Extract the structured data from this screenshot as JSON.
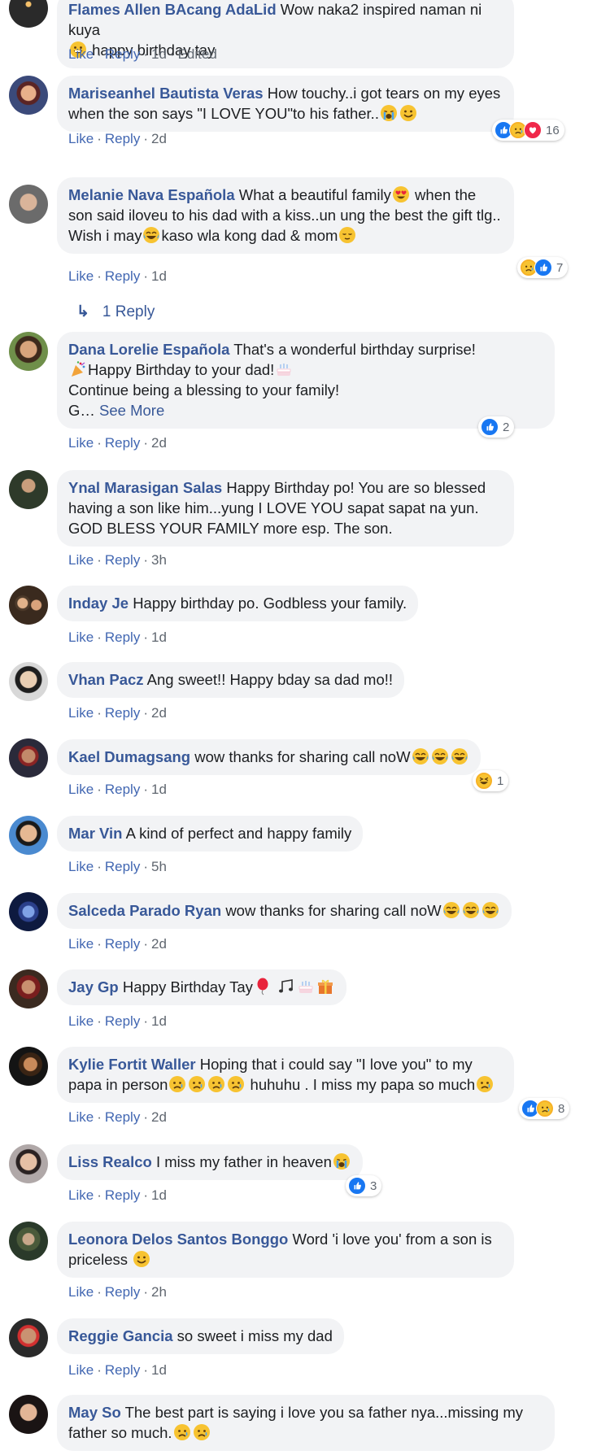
{
  "actions": {
    "like": "Like",
    "reply": "Reply",
    "sep": "·",
    "edited": "Edited"
  },
  "comments": [
    {
      "author": "Flames Allen BAcang AdaLid",
      "parts": [
        "Wow naka2 inspired naman ni kuya",
        "happy birthday tay"
      ],
      "time": "1d",
      "edited": true
    },
    {
      "author": "Mariseanhel Bautista Veras",
      "parts": [
        "How touchy..i got tears on my eyes when the son says \"I LOVE YOU\"to his father.."
      ],
      "time": "2d",
      "reaction_count": "16"
    },
    {
      "author": "Melanie Nava Española",
      "parts": [
        "What a beautiful family",
        " when the son said iloveu to his dad with a kiss..un ung the best the gift tlg.. Wish i may",
        "kaso wla kong dad & mom"
      ],
      "time": "1d",
      "reaction_count": "7",
      "replies_label": "1 Reply"
    },
    {
      "author": "Dana Lorelie Española",
      "parts": [
        "That's a wonderful birthday surprise!",
        "Happy Birthday to your dad!",
        "Continue being a blessing to your family!",
        "G…"
      ],
      "see_more": "See More",
      "time": "2d",
      "reaction_count": "2"
    },
    {
      "author": "Ynal Marasigan Salas",
      "parts": [
        "Happy Birthday po! You are so blessed having a son like him...yung I LOVE YOU sapat sapat na yun. GOD BLESS YOUR FAMILY more esp. The son."
      ],
      "time": "3h"
    },
    {
      "author": "Inday Je",
      "parts": [
        "Happy birthday po. Godbless your family."
      ],
      "time": "1d"
    },
    {
      "author": "Vhan Pacz",
      "parts": [
        "Ang sweet!! Happy bday sa dad mo!!"
      ],
      "time": "2d"
    },
    {
      "author": "Kael Dumagsang",
      "parts": [
        "wow thanks for sharing call noW"
      ],
      "time": "1d",
      "reaction_count": "1"
    },
    {
      "author": "Mar Vin",
      "parts": [
        "A kind of perfect and happy family"
      ],
      "time": "5h"
    },
    {
      "author": "Salceda Parado Ryan",
      "parts": [
        "wow thanks for sharing call noW"
      ],
      "time": "2d"
    },
    {
      "author": "Jay Gp",
      "parts": [
        "Happy Birthday Tay"
      ],
      "time": "1d"
    },
    {
      "author": "Kylie Fortit Waller",
      "parts": [
        "Hoping that i could say \"I love you\" to my papa in person",
        " huhuhu . I miss my papa so much"
      ],
      "time": "2d",
      "reaction_count": "8"
    },
    {
      "author": "Liss Realco",
      "parts": [
        "I miss my father in heaven"
      ],
      "time": "1d",
      "reaction_count": "3"
    },
    {
      "author": "Leonora Delos Santos Bonggo",
      "parts": [
        "Word 'i love you' from a son is priceless"
      ],
      "time": "2h"
    },
    {
      "author": "Reggie Gancia",
      "parts": [
        "so sweet i miss my dad"
      ],
      "time": "1d"
    },
    {
      "author": "May So",
      "parts": [
        "The best part is saying i love you sa father nya...missing my father so much."
      ],
      "time": ""
    }
  ],
  "icons": [
    "like-icon",
    "sad-icon",
    "love-icon",
    "haha-icon",
    "reply-arrow-icon"
  ],
  "colors": {
    "author": "#385898",
    "bubble": "#f2f3f5",
    "like": "#1877f2",
    "love": "#f0284a",
    "emoji": "#f7b125"
  }
}
